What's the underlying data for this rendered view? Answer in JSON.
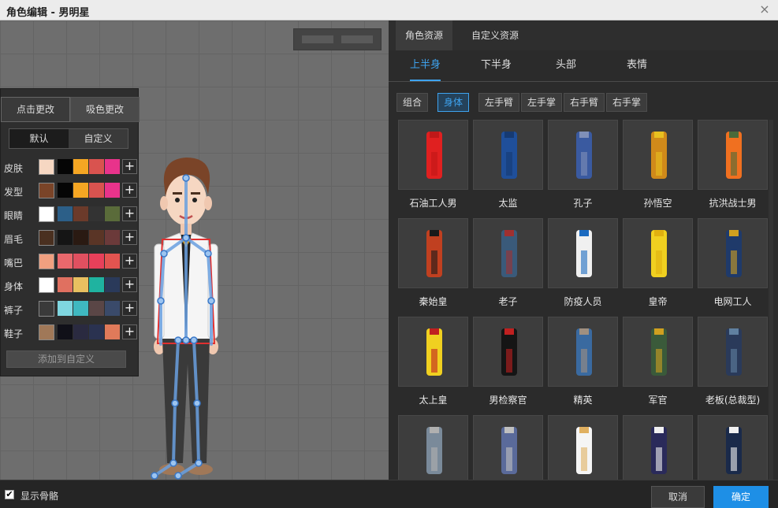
{
  "window": {
    "title": "角色编辑 - 男明星",
    "close_icon": "×"
  },
  "color_panel": {
    "tabs": [
      "点击更改",
      "吸色更改"
    ],
    "modes": [
      "默认",
      "自定义"
    ],
    "rows": [
      {
        "label": "皮肤",
        "current": "#f6d7c2",
        "swatches": [
          "#050505",
          "#f5a623",
          "#d9534f",
          "#e8338b"
        ]
      },
      {
        "label": "发型",
        "current": "#7a4428",
        "swatches": [
          "#050505",
          "#f5a623",
          "#d9534f",
          "#e8338b"
        ]
      },
      {
        "label": "眼睛",
        "current": "#ffffff",
        "swatches": [
          "#2c5f88",
          "#6b3a2a",
          "#333333",
          "#5a6b3a"
        ]
      },
      {
        "label": "眉毛",
        "current": "#4a3020",
        "swatches": [
          "#151515",
          "#2a1a12",
          "#5a3526",
          "#6b3a3a"
        ]
      },
      {
        "label": "嘴巴",
        "current": "#f0a080",
        "swatches": [
          "#e9686c",
          "#e05060",
          "#e8405a",
          "#e35450"
        ]
      },
      {
        "label": "身体",
        "current": "#ffffff",
        "swatches": [
          "#e07060",
          "#e8c060",
          "#1fb3a0",
          "#2a3a5a"
        ]
      },
      {
        "label": "裤子",
        "current": "#3a3a3a",
        "swatches": [
          "#7fd6e0",
          "#3fb8c0",
          "#5a4646",
          "#3a4a6a"
        ]
      },
      {
        "label": "鞋子",
        "current": "#a07858",
        "swatches": [
          "#101018",
          "#2a2a40",
          "#2a3250",
          "#e07a5a"
        ]
      }
    ],
    "plus_icon": "+",
    "add_label": "添加到自定义"
  },
  "right": {
    "tabs": [
      "角色资源",
      "自定义资源"
    ],
    "sub_tabs": [
      "上半身",
      "下半身",
      "头部",
      "表情"
    ],
    "chips": [
      "组合",
      "身体",
      "左手臂",
      "左手掌",
      "右手臂",
      "右手掌"
    ],
    "items": [
      {
        "label": "石油工人男",
        "color": "#e02020",
        "accent": "#c01818"
      },
      {
        "label": "太监",
        "color": "#1f4f9a",
        "accent": "#163a72"
      },
      {
        "label": "孔子",
        "color": "#3a5aa0",
        "accent": "#8090b8"
      },
      {
        "label": "孙悟空",
        "color": "#d08a1a",
        "accent": "#e8c020"
      },
      {
        "label": "抗洪战士男",
        "color": "#f07020",
        "accent": "#4a6a3a"
      },
      {
        "label": "秦始皇",
        "color": "#c04020",
        "accent": "#1a1a1a"
      },
      {
        "label": "老子",
        "color": "#3a5a7a",
        "accent": "#a03030"
      },
      {
        "label": "防疫人员",
        "color": "#f0f0f0",
        "accent": "#1a6ac0"
      },
      {
        "label": "皇帝",
        "color": "#f0d020",
        "accent": "#e0b010"
      },
      {
        "label": "电网工人",
        "color": "#1f3a6a",
        "accent": "#d0a020"
      },
      {
        "label": "太上皇",
        "color": "#f0d020",
        "accent": "#c02020"
      },
      {
        "label": "男检察官",
        "color": "#151515",
        "accent": "#c02020"
      },
      {
        "label": "精英",
        "color": "#3a6aa0",
        "accent": "#a09080"
      },
      {
        "label": "军官",
        "color": "#3a5a3a",
        "accent": "#d0a020"
      },
      {
        "label": "老板(总裁型)",
        "color": "#2a3a5a",
        "accent": "#6080a0"
      },
      {
        "label": "",
        "color": "#7a8a9a",
        "accent": "#b0b0b0"
      },
      {
        "label": "",
        "color": "#5a6a9a",
        "accent": "#c0c0c0"
      },
      {
        "label": "",
        "color": "#f5f5f5",
        "accent": "#e0b060"
      },
      {
        "label": "",
        "color": "#2a2a5a",
        "accent": "#f0f0f0"
      },
      {
        "label": "",
        "color": "#1a2a4a",
        "accent": "#f0f0f0"
      }
    ]
  },
  "bottom": {
    "checkbox_label": "显示骨骼",
    "checked": true,
    "cancel": "取消",
    "confirm": "确定"
  },
  "colors": {
    "accent": "#3ea3ef",
    "primary_button": "#1e8fe6"
  }
}
